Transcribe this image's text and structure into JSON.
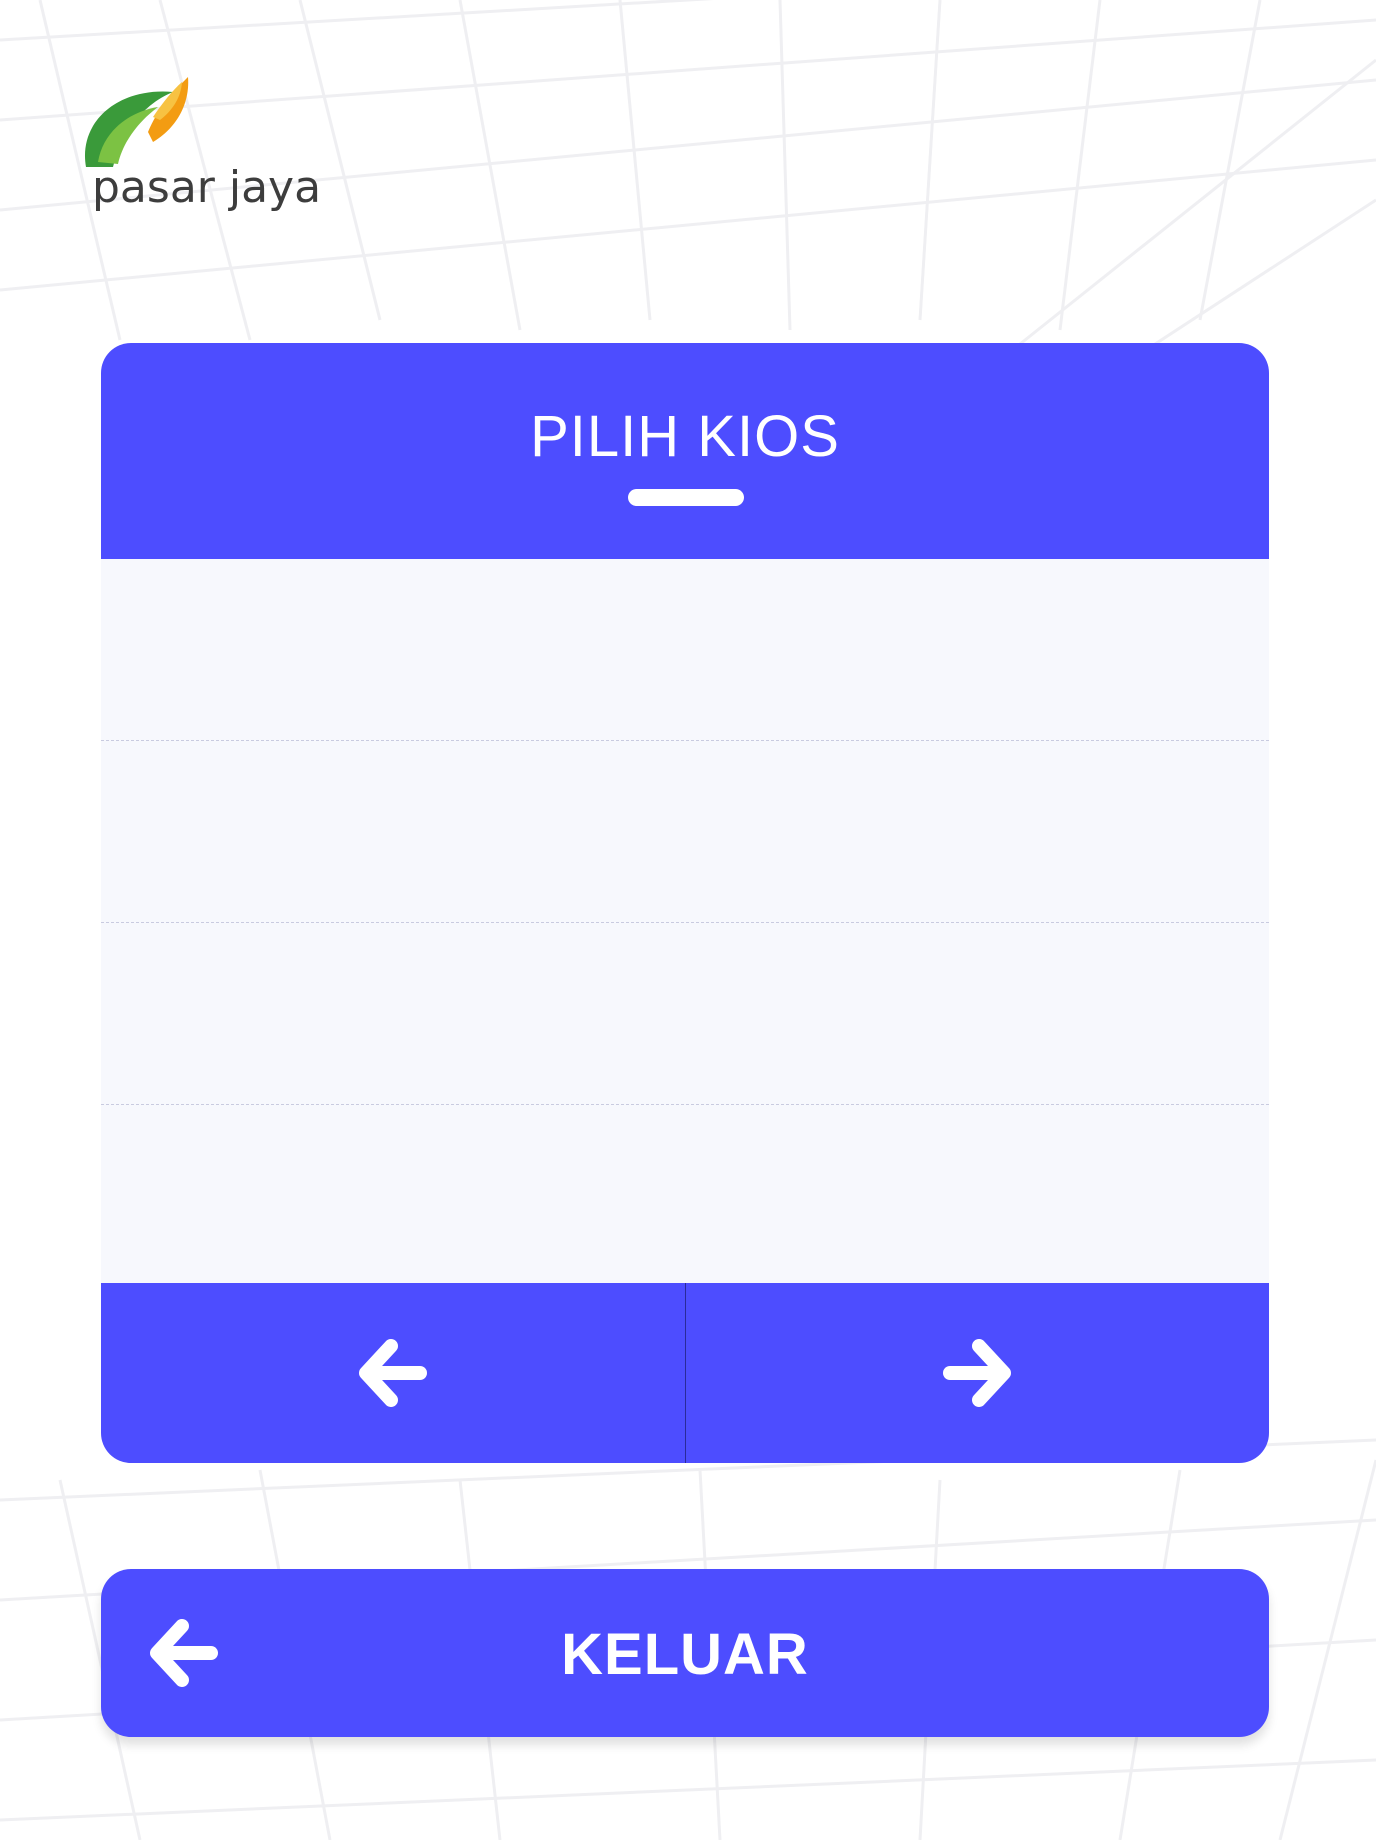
{
  "brand": {
    "logo_text": "pasar jaya",
    "colors": {
      "leaf_green": "#3a9a3a",
      "leaf_orange": "#f39c12",
      "text": "#3d3d3d"
    }
  },
  "kios_panel": {
    "title": "PILIH KIOS",
    "accent_color": "#4d4dff",
    "list_background": "#f7f8fd",
    "rows": [
      "",
      "",
      "",
      ""
    ],
    "pagination": {
      "prev_icon": "arrow-left-icon",
      "next_icon": "arrow-right-icon"
    }
  },
  "logout": {
    "label": "KELUAR",
    "icon": "arrow-left-icon"
  }
}
